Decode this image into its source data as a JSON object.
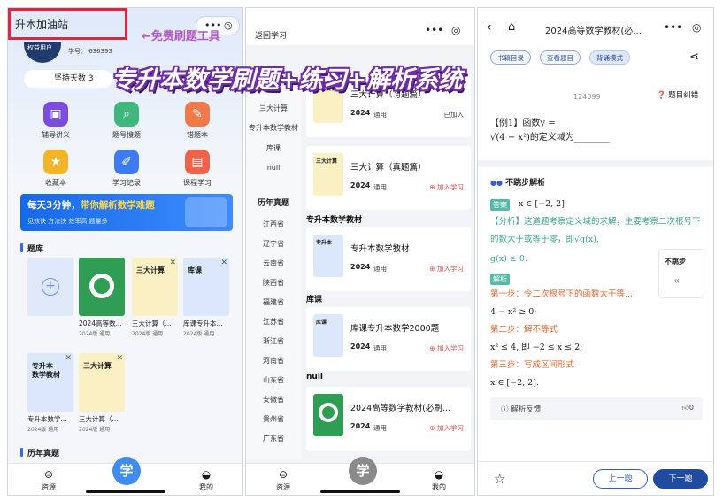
{
  "overlay": {
    "promo_text": "←免费刷题工具",
    "headline": "专升本数学刷题+练习+解析系统"
  },
  "colors": {
    "primary": "#2f6ce8",
    "dark_blue": "#1f4c9e",
    "highlight_red": "#e0263a",
    "headline_outline": "#6e2ea8",
    "accent_orange": "#e6672f",
    "accent_teal": "#3aa28e"
  },
  "phone1": {
    "title": "升本加油站",
    "capsule_icons": [
      "more-icon",
      "target-icon"
    ],
    "user": {
      "badge": "权益用户",
      "student_no": "学号： 636393"
    },
    "streak": "坚持天数  3",
    "grid": [
      {
        "label": "辅导讲义",
        "icon": "book-icon",
        "color": "#7b4ce0"
      },
      {
        "label": "题号搜题",
        "icon": "search-icon",
        "color": "#3fb87e"
      },
      {
        "label": "错题本",
        "icon": "wrong-book-icon",
        "color": "#f0794a"
      },
      {
        "label": "收藏本",
        "icon": "star-icon",
        "color": "#f2b428"
      },
      {
        "label": "学习记录",
        "icon": "pen-icon",
        "color": "#3f7bf0"
      },
      {
        "label": "课程学习",
        "icon": "course-icon",
        "color": "#f0624a"
      }
    ],
    "banner": {
      "text_a": "每天3分钟，",
      "text_b": "带你解析数学难题",
      "tags": "见效快  方法快  效率高  题量多"
    },
    "section_bank": "题库",
    "books": [
      {
        "title": "",
        "sub": "",
        "cover": "add"
      },
      {
        "title": "2024高等数...",
        "sub": "2024版 通用",
        "cover": "green",
        "cover_text": ""
      },
      {
        "title": "三大计算（...",
        "sub": "2024版 通用",
        "cover": "yellow",
        "cover_text": "三大计算"
      },
      {
        "title": "库课专升本...",
        "sub": "2024版 通用",
        "cover": "blue",
        "cover_text": "库课"
      },
      {
        "title": "专升本数学...",
        "sub": "2024版 通用",
        "cover": "blue",
        "cover_text": "专升本\n数学教材"
      },
      {
        "title": "三大计算（...",
        "sub": "2024版 通用",
        "cover": "yellow",
        "cover_text": "三大计算"
      }
    ],
    "section_past": "历年真题",
    "tabs": {
      "left": "资源",
      "center": "学",
      "right": "我的"
    }
  },
  "phone2": {
    "back": "返回学习",
    "capsule_icons": [
      "more-icon",
      "target-icon"
    ],
    "side_top": [
      "三大计算",
      "专升本数学教材",
      "库课",
      "null"
    ],
    "side_head": "历年真题",
    "side_provinces": [
      "江西省",
      "辽宁省",
      "云南省",
      "陕西省",
      "福建省",
      "江苏省",
      "浙江省",
      "河南省",
      "山东省",
      "安徽省",
      "贵州省",
      "广东省"
    ],
    "cards": [
      {
        "name": "三大计算（习题篇）",
        "year": "2024",
        "tag": "通用",
        "action": "已加入",
        "cover": "yellow",
        "cover_text": "三大计算"
      },
      {
        "name": "三大计算（真题篇）",
        "year": "2024",
        "tag": "通用",
        "action": "⊕ 加入学习",
        "cover": "yellow",
        "cover_text": "三大计算"
      },
      {
        "name": "专升本数学教材",
        "year": "2024",
        "tag": "通用",
        "action": "⊕ 加入学习",
        "cover": "blue",
        "cover_text": "专升本"
      },
      {
        "name": "库课专升本数学2000题",
        "year": "2024",
        "tag": "通用",
        "action": "⊕ 加入学习",
        "cover": "blue",
        "cover_text": "库课"
      },
      {
        "name": "2024高等数学教材(必刷...",
        "year": "2024",
        "tag": "通用",
        "action": "⊕ 加入学习",
        "cover": "green",
        "cover_text": ""
      }
    ],
    "sections": [
      "专升本数学教材",
      "库课",
      "null"
    ],
    "tabs": {
      "left": "资源",
      "center": "学",
      "right": "我的"
    }
  },
  "phone3": {
    "title": "2024高等数学教材(必...",
    "capsule_icons": [
      "more-icon",
      "target-icon"
    ],
    "pills": [
      "书籍目录",
      "查看题目",
      "背诵模式"
    ],
    "qid": "124099",
    "report": "题目纠错",
    "question_a": "【例1】函数y =",
    "question_b": "√(4 − x²)的定义域为________",
    "mode": "不跳步解析",
    "answer_badge": "答案",
    "answer_value": "x ∈ [−2, 2]",
    "analysis_label": "【分析】",
    "analysis_text": "这道题考察定义域的求解，主要考察二次根号下的数大于或等于零，即√g(x),",
    "analysis_tail": "g(x) ≥ 0.",
    "solution_badge": "解析",
    "step1": "第一步：令二次根号下的函数大于等...",
    "step1_math": "4 − x² ≥ 0;",
    "step2": "第二步：解不等式",
    "step2_math": "x² ≤ 4,  即 −2 ≤ x ≤ 2;",
    "step3": "第三步：写成区间形式",
    "step3_math": "x ∈ [−2, 2].",
    "float_label": "不跳步",
    "feedback": "解析反馈",
    "like_count": "0",
    "prev": "上一题",
    "next": "下一题"
  }
}
